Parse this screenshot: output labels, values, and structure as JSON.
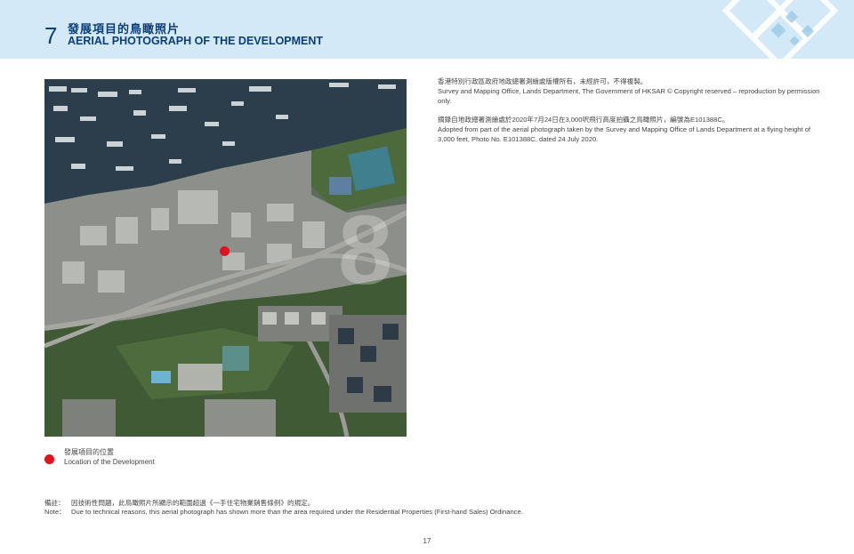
{
  "header": {
    "section_number": "7",
    "title_cn": "發展項目的鳥瞰照片",
    "title_en": "AERIAL PHOTOGRAPH OF THE DEVELOPMENT"
  },
  "credits": {
    "copyright_cn": "香港特別行政區政府地政總署測繪處版權所有，未經許可，不得複製。",
    "copyright_en": "Survey and Mapping Office, Lands Department, The Government of HKSAR © Copyright reserved – reproduction by permission only.",
    "source_cn": "摘錄自地政總署測繪處於2020年7月24日在3,000呎飛行高度拍攝之鳥瞰照片，編號為E101388C。",
    "source_en": "Adopted from part of the aerial photograph taken by the Survey and Mapping Office of Lands Department at a flying height of 3,000 feet, Photo No. E101388C, dated 24 July 2020."
  },
  "legend": {
    "label_cn": "發展項目的位置",
    "label_en": "Location of the Development",
    "marker_color": "#e1141b"
  },
  "note": {
    "label_cn": "備註：",
    "text_cn": "因技術性問題，此鳥瞰照片所顯示的範圍超過《一手住宅物業銷售條例》的規定。",
    "label_en": "Note：",
    "text_en": "Due to technical reasons, this aerial photograph has shown more than the area required under the Residential Properties (First-hand Sales) Ordinance."
  },
  "page_number": "17",
  "colors": {
    "header_bg": "#d3e9f7",
    "title": "#0a3d7a",
    "marker": "#e1141b"
  }
}
